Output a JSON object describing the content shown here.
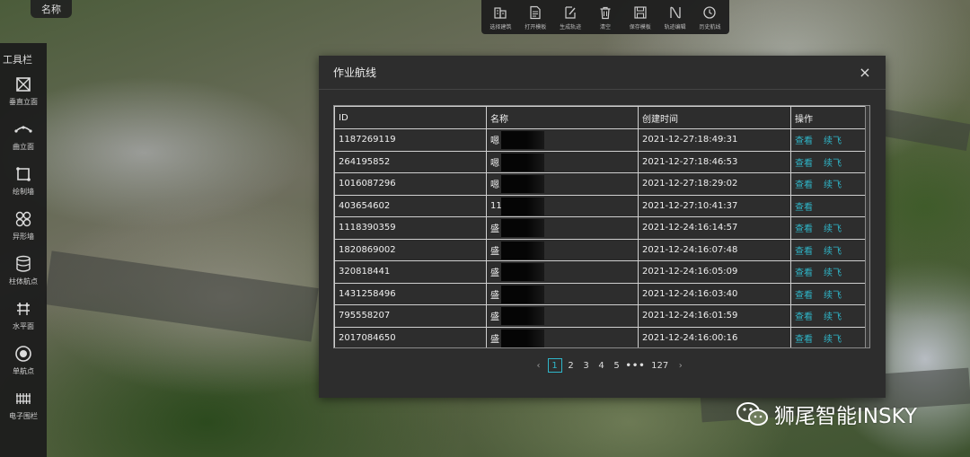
{
  "name_chip": "名称",
  "toolbar": {
    "title": "工具栏",
    "items": [
      {
        "label": "垂直立面",
        "icon": "vertical-facade-icon"
      },
      {
        "label": "曲立面",
        "icon": "curved-facade-icon"
      },
      {
        "label": "绘制墙",
        "icon": "draw-wall-icon"
      },
      {
        "label": "异形墙",
        "icon": "irregular-wall-icon"
      },
      {
        "label": "柱体航点",
        "icon": "cylinder-waypoint-icon"
      },
      {
        "label": "水平面",
        "icon": "horizontal-plane-icon"
      },
      {
        "label": "单航点",
        "icon": "single-waypoint-icon"
      },
      {
        "label": "电子围栏",
        "icon": "geofence-icon"
      }
    ]
  },
  "top_toolbar": {
    "items": [
      {
        "label": "选择建筑",
        "icon": "select-building-icon"
      },
      {
        "label": "打开模板",
        "icon": "open-template-icon"
      },
      {
        "label": "生成轨迹",
        "icon": "generate-track-icon"
      },
      {
        "label": "清空",
        "icon": "trash-icon"
      },
      {
        "label": "保存模板",
        "icon": "save-template-icon"
      },
      {
        "label": "轨迹编辑",
        "icon": "track-edit-icon"
      },
      {
        "label": "历史航线",
        "icon": "history-route-icon"
      }
    ]
  },
  "dialog": {
    "title": "作业航线",
    "close": "×",
    "columns": [
      "ID",
      "名称",
      "创建时间",
      "操作"
    ],
    "rows": [
      {
        "id": "1187269119",
        "name": "嗯",
        "time": "2021-12-27:18:49:31",
        "view": "查看",
        "resume": "续飞"
      },
      {
        "id": "264195852",
        "name": "嗯",
        "time": "2021-12-27:18:46:53",
        "view": "查看",
        "resume": "续飞"
      },
      {
        "id": "1016087296",
        "name": "嗯",
        "time": "2021-12-27:18:29:02",
        "view": "查看",
        "resume": "续飞"
      },
      {
        "id": "403654602",
        "name": "11",
        "time": "2021-12-27:10:41:37",
        "view": "查看",
        "resume": ""
      },
      {
        "id": "1118390359",
        "name": "盛",
        "time": "2021-12-24:16:14:57",
        "view": "查看",
        "resume": "续飞"
      },
      {
        "id": "1820869002",
        "name": "盛",
        "time": "2021-12-24:16:07:48",
        "view": "查看",
        "resume": "续飞"
      },
      {
        "id": "320818441",
        "name": "盛",
        "time": "2021-12-24:16:05:09",
        "view": "查看",
        "resume": "续飞"
      },
      {
        "id": "1431258496",
        "name": "盛",
        "time": "2021-12-24:16:03:40",
        "view": "查看",
        "resume": "续飞"
      },
      {
        "id": "795558207",
        "name": "盛",
        "time": "2021-12-24:16:01:59",
        "view": "查看",
        "resume": "续飞"
      },
      {
        "id": "2017084650",
        "name": "盛",
        "time": "2021-12-24:16:00:16",
        "view": "查看",
        "resume": "续飞"
      }
    ],
    "pagination": {
      "prev": "‹",
      "pages": [
        "1",
        "2",
        "3",
        "4",
        "5"
      ],
      "current": "1",
      "ellipsis": "•••",
      "last": "127",
      "next": "›"
    }
  },
  "watermark": {
    "text": "狮尾智能INSKY"
  },
  "colors": {
    "accent": "#2fb6c9",
    "panel": "#2d2d2d",
    "toolbar": "#1c1c1c"
  }
}
